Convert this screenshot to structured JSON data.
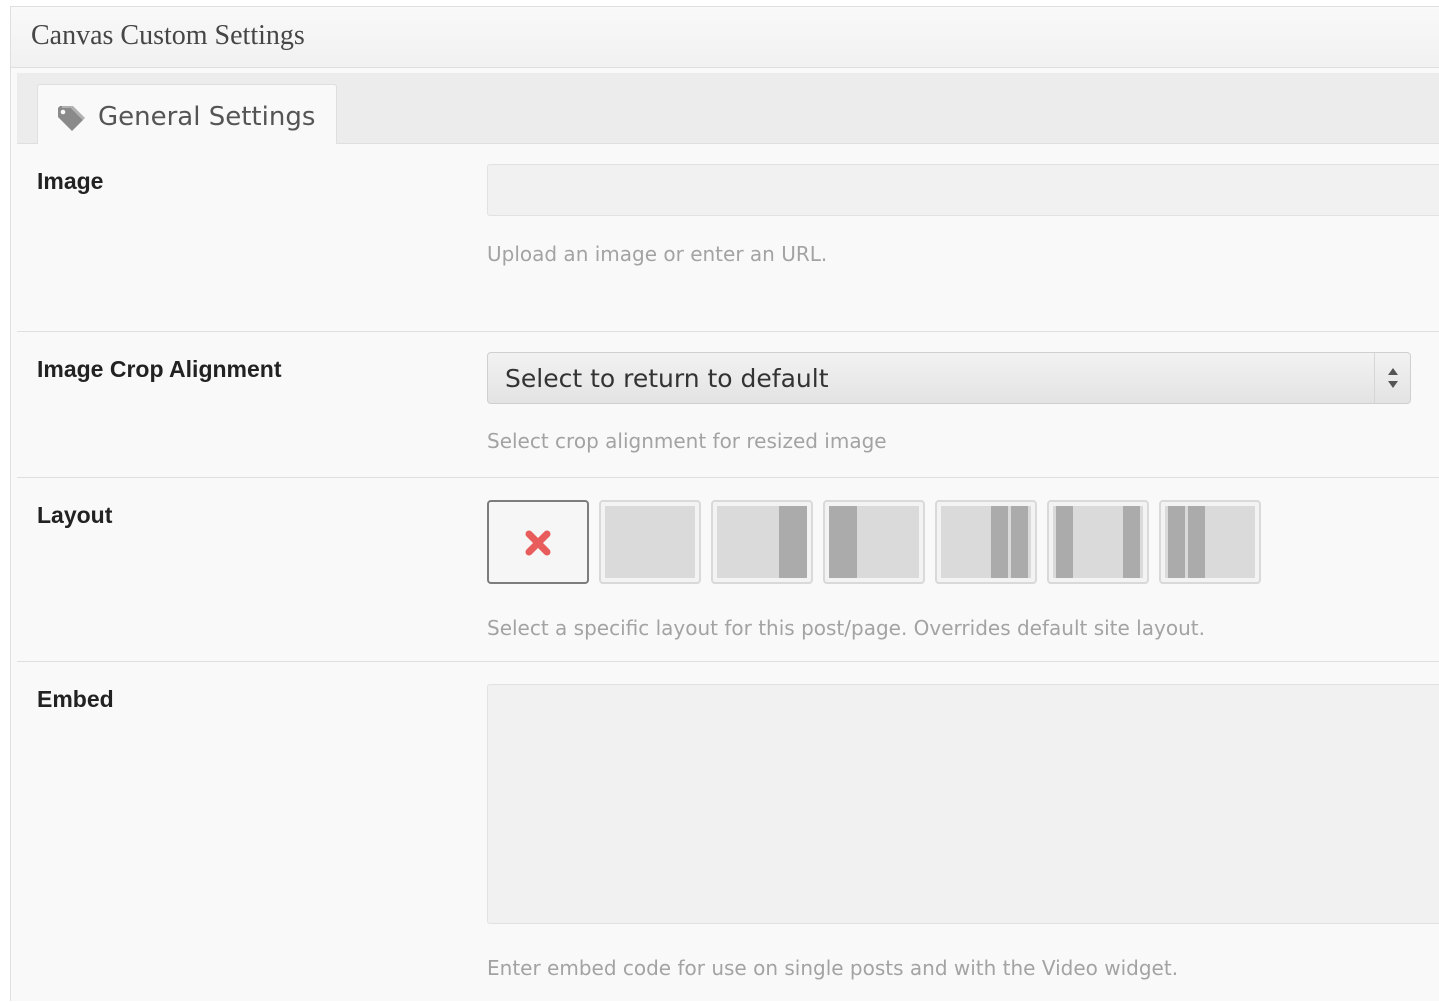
{
  "panel": {
    "title": "Canvas Custom Settings"
  },
  "tabs": [
    {
      "label": "General Settings",
      "icon": "tag-icon"
    }
  ],
  "fields": {
    "image": {
      "label": "Image",
      "value": "",
      "description": "Upload an image or enter an URL."
    },
    "crop": {
      "label": "Image Crop Alignment",
      "selected": "Select to return to default",
      "description": "Select crop alignment for resized image"
    },
    "layout": {
      "label": "Layout",
      "options": [
        "default",
        "one-col",
        "two-col-left",
        "two-col-right",
        "three-col-left",
        "three-col-middle",
        "three-col-right"
      ],
      "selected_index": 0,
      "description": "Select a specific layout for this post/page. Overrides default site layout."
    },
    "embed": {
      "label": "Embed",
      "value": "",
      "description": "Enter embed code for use on single posts and with the Video widget."
    }
  },
  "colors": {
    "panel_bg": "#f9f9f9",
    "border": "#dfdfdf",
    "description": "#a3a3a3",
    "default_x": "#e85c5c"
  }
}
